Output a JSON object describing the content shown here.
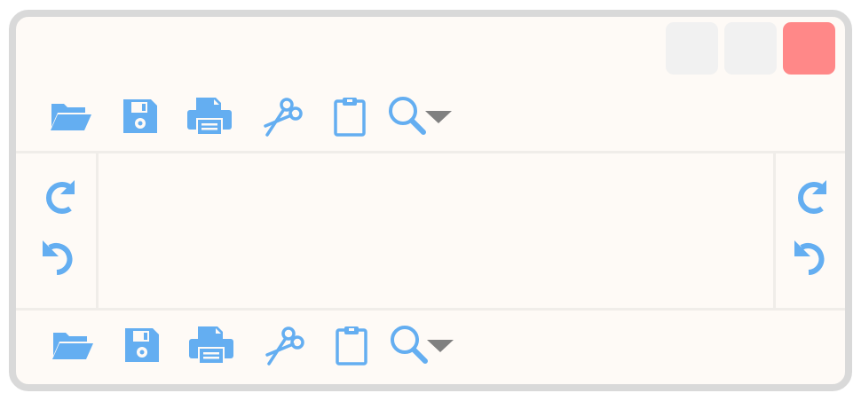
{
  "window": {
    "controls": [
      "minimize-button",
      "maximize-button",
      "close-button"
    ],
    "colors": {
      "frame": "#d9d9d9",
      "background": "#fefaf6",
      "icon": "#64aef1",
      "dropdown_arrow": "#808080",
      "control": "#f1f1f1",
      "close": "#ff8888"
    }
  },
  "toolbars": {
    "top": [
      "folder-open-icon",
      "save-icon",
      "print-icon",
      "scissors-icon",
      "clipboard-icon",
      "search-icon",
      "chevron-down-icon"
    ],
    "bottom": [
      "folder-open-icon",
      "save-icon",
      "print-icon",
      "scissors-icon",
      "clipboard-icon",
      "search-icon",
      "chevron-down-icon"
    ]
  },
  "side_panels": {
    "left": [
      "redo-icon",
      "undo-icon"
    ],
    "right": [
      "redo-icon",
      "undo-icon"
    ]
  }
}
